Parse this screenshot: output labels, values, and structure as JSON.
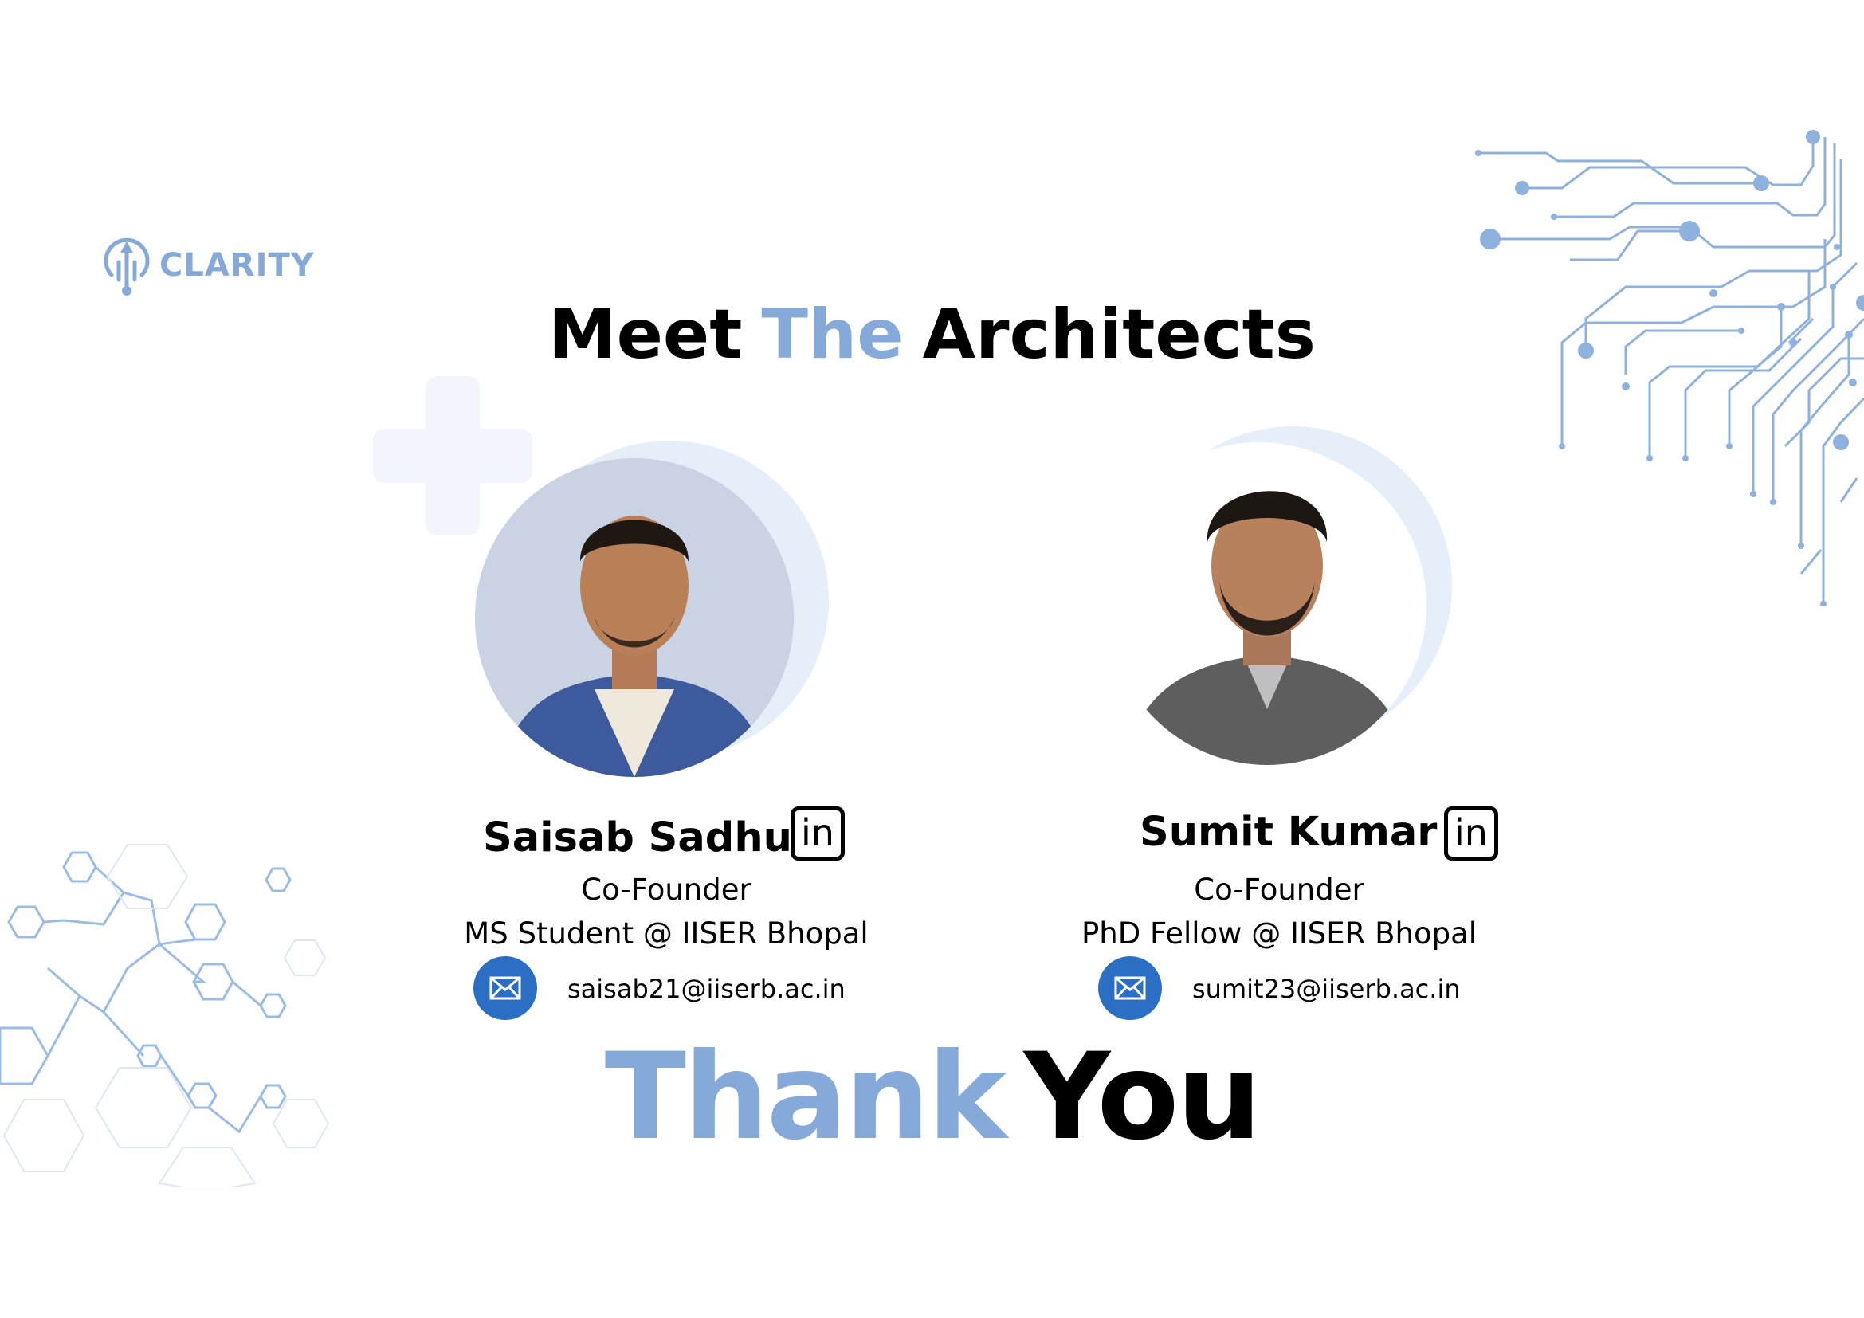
{
  "brand": {
    "name": "CLARITY",
    "color": "#85a9d9"
  },
  "heading": {
    "word1": "Meet",
    "word2": "The",
    "word3": "Architects"
  },
  "people": [
    {
      "name": "Saisab Sadhu",
      "role": "Co-Founder",
      "affiliation": "MS Student @ IISER Bhopal",
      "email": "saisab21@iiserb.ac.in",
      "social": "in"
    },
    {
      "name": "Sumit Kumar",
      "role": "Co-Founder",
      "affiliation": "PhD Fellow @ IISER Bhopal",
      "email": "sumit23@iiserb.ac.in",
      "social": "in"
    }
  ],
  "closing": {
    "word1": "Thank",
    "word2": "You"
  },
  "colors": {
    "accent": "#85a9d9",
    "mail": "#2a6fc4",
    "decor": "#9bbce6"
  },
  "icons": [
    "clarity-logo-icon",
    "mail-icon",
    "linkedin-icon",
    "circuit-decoration",
    "hexagon-decoration"
  ]
}
